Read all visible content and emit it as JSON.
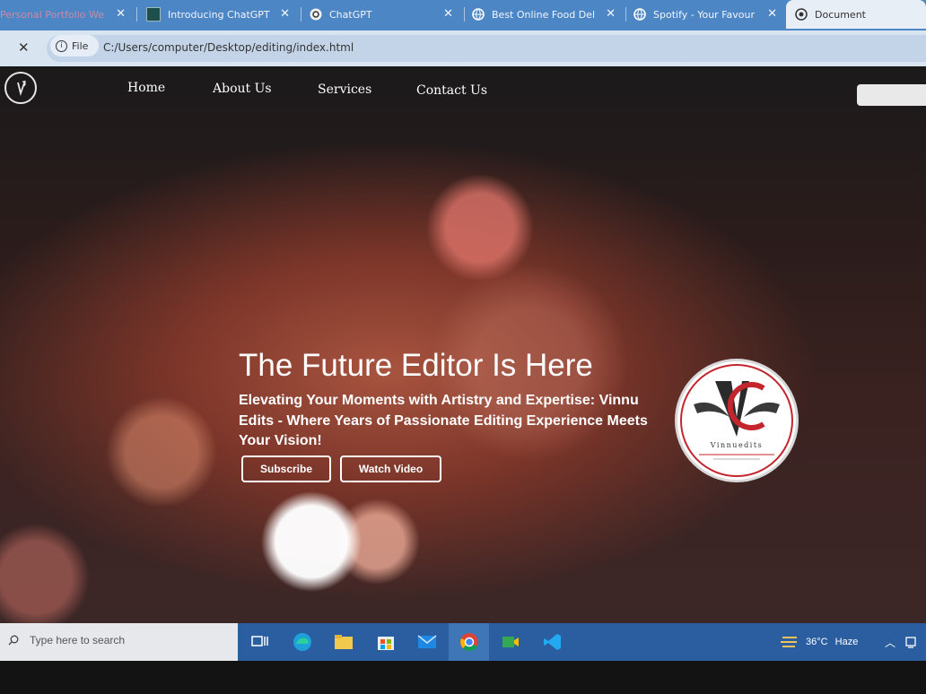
{
  "tabs": [
    {
      "title": "Personal Portfolio We"
    },
    {
      "title": "Introducing ChatGPT"
    },
    {
      "title": "ChatGPT"
    },
    {
      "title": "Best Online Food Del"
    },
    {
      "title": "Spotify - Your Favour"
    },
    {
      "title": "Document"
    }
  ],
  "address": {
    "file_label": "File",
    "url": "C:/Users/computer/Desktop/editing/index.html"
  },
  "nav": {
    "items": [
      "Home",
      "About Us",
      "Services",
      "Contact Us"
    ]
  },
  "hero": {
    "title": "The Future Editor Is Here",
    "subtitle": "Elevating Your Moments with Artistry and Expertise: Vinnu Edits - Where Years of Passionate Editing Experience Meets Your Vision!",
    "subscribe_label": "Subscribe",
    "watch_label": "Watch Video"
  },
  "brand": {
    "logo_text": "Vinnuedits",
    "logo_letters": "VE"
  },
  "taskbar": {
    "search_placeholder": "Type here to search",
    "weather_temp": "36°C",
    "weather_desc": "Haze"
  },
  "colors": {
    "tabbar": "#4d86c5",
    "addressbar": "#d9e4f1",
    "taskbar": "#2a5ea0",
    "brand_red": "#c4262e"
  }
}
